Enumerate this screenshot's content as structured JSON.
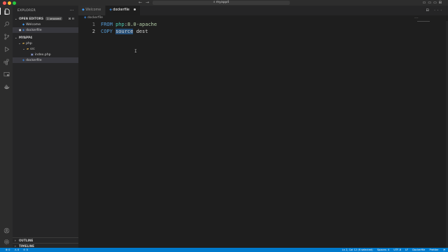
{
  "window": {
    "title": "myapp4"
  },
  "activity": [
    "explorer-icon",
    "search-icon",
    "source-control-icon",
    "run-debug-icon",
    "extensions-icon",
    "remote-explorer-icon",
    "docker-icon",
    "account-icon",
    "settings-gear-icon"
  ],
  "sidebar": {
    "header": "EXPLORER",
    "open_editors": {
      "label": "OPEN EDITORS",
      "badge": "1 unsaved",
      "items": [
        {
          "name": "Welcome",
          "icon": "vscode-icon"
        },
        {
          "name": "dockerfile",
          "icon": "docker-icon",
          "unsaved": true
        }
      ]
    },
    "project": {
      "label": "MYAPP4",
      "tree": [
        {
          "name": "php",
          "type": "folder"
        },
        {
          "name": "src",
          "type": "folder"
        },
        {
          "name": "index.php",
          "type": "file"
        },
        {
          "name": "dockerfile",
          "type": "file"
        }
      ]
    },
    "outline_label": "OUTLINE",
    "timeline_label": "TIMELINE"
  },
  "tabs": [
    {
      "label": "Welcome",
      "active": false
    },
    {
      "label": "dockerfile",
      "active": true,
      "dirty": true
    }
  ],
  "breadcrumb": "dockerfile",
  "code": {
    "line1": {
      "num": "1",
      "kw": "FROM",
      "image": "php",
      "sep": ":",
      "tag": "8.0-apache"
    },
    "line2": {
      "num": "2",
      "kw": "COPY",
      "src": "source",
      "dest": "dest"
    }
  },
  "status": {
    "left": [
      "⊗ 0",
      "⚠ 0",
      "⊙ 0"
    ],
    "right": [
      "Ln 2, Col 12 (6 selected)",
      "Spaces: 4",
      "UTF-8",
      "LF",
      "Dockerfile",
      "Prettier"
    ]
  },
  "colors": {
    "accent": "#007acc",
    "editor_bg": "#1e1e1e",
    "sidebar_bg": "#252526",
    "activity_bg": "#2c2c2c"
  }
}
